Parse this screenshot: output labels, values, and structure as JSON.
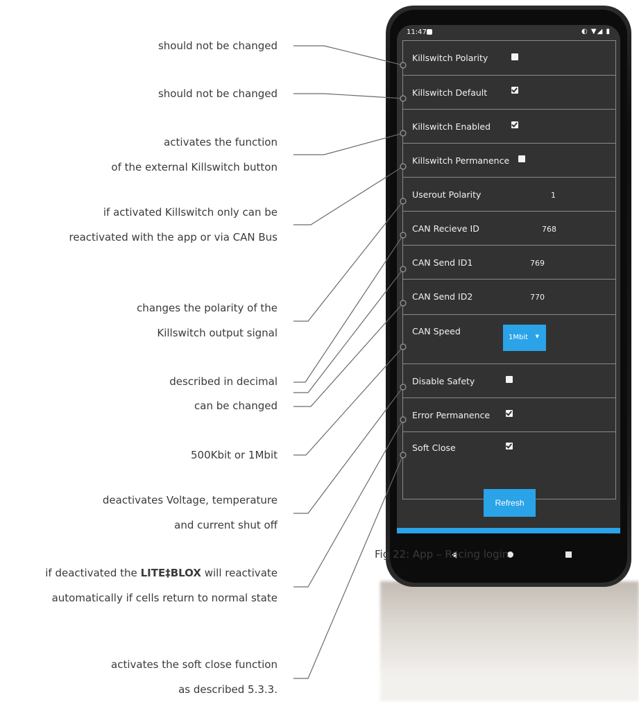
{
  "annotations": [
    {
      "lines": [
        "should not be changed"
      ]
    },
    {
      "lines": [
        "should not be changed"
      ]
    },
    {
      "lines": [
        "activates the function",
        "of the external Killswitch button"
      ]
    },
    {
      "lines": [
        "if activated Killswitch only can be",
        "reactivated with the app or via CAN Bus"
      ]
    },
    {
      "lines": [
        "changes the polarity of the",
        "Killswitch output signal"
      ]
    },
    {
      "lines": [
        "described in decimal"
      ]
    },
    {
      "lines": [
        "can be changed"
      ]
    },
    {
      "lines": [
        "500Kbit or 1Mbit"
      ]
    },
    {
      "lines": [
        "deactivates Voltage, temperature",
        "and current shut off"
      ]
    },
    {
      "lines": [
        "if deactivated the",
        "will reactivate",
        "automatically if cells return to normal state"
      ],
      "brand": "LITE‡BLOX"
    },
    {
      "lines": [
        "activates the soft close function",
        "as described 5.3.3."
      ]
    }
  ],
  "status_bar": {
    "time": "11:47",
    "icons": "◐ ▼◢ ▮"
  },
  "settings": [
    {
      "label": "Killswitch Polarity",
      "type": "checkbox",
      "checked": false
    },
    {
      "label": "Killswitch Default",
      "type": "checkbox",
      "checked": true
    },
    {
      "label": "Killswitch Enabled",
      "type": "checkbox",
      "checked": true
    },
    {
      "label": "Killswitch Permanence",
      "type": "checkbox",
      "checked": false
    },
    {
      "label": "Userout Polarity",
      "type": "value",
      "value": "1"
    },
    {
      "label": "CAN Recieve ID",
      "type": "value",
      "value": "768"
    },
    {
      "label": "CAN Send ID1",
      "type": "value",
      "value": "769"
    },
    {
      "label": "CAN Send ID2",
      "type": "value",
      "value": "770"
    },
    {
      "label": "CAN Speed",
      "type": "select",
      "value": "1Mbit"
    },
    {
      "label": "Disable Safety",
      "type": "checkbox",
      "checked": false
    },
    {
      "label": "Error Permanence",
      "type": "checkbox",
      "checked": true
    },
    {
      "label": "Soft Close",
      "type": "checkbox",
      "checked": true
    }
  ],
  "refresh_label": "Refresh",
  "caption": "Fig 22: App – Racing login",
  "colors": {
    "accent": "#2aa3e8",
    "screen_bg": "#323232"
  }
}
